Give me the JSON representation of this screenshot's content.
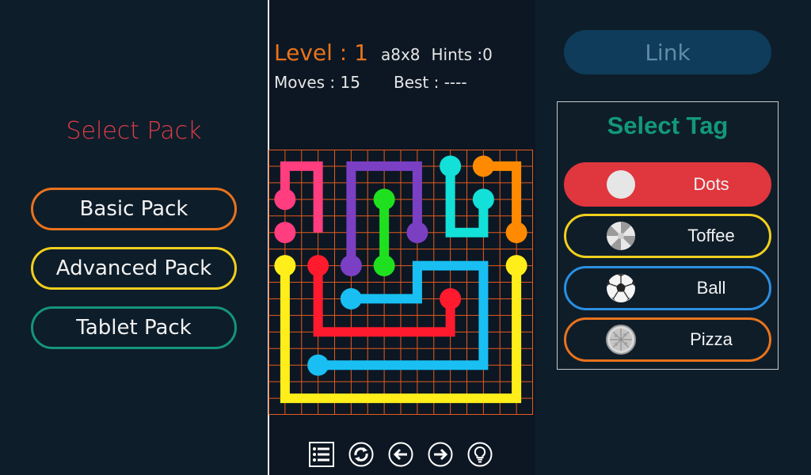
{
  "select_pack": {
    "title": "Select Pack",
    "buttons": [
      {
        "label": "Basic Pack",
        "color": "#e9731c"
      },
      {
        "label": "Advanced Pack",
        "color": "#f0cf1e"
      },
      {
        "label": "Tablet Pack",
        "color": "#14957a"
      }
    ]
  },
  "game": {
    "level_label": "Level : 1",
    "grid_size": "a8x8",
    "hints": "Hints :0",
    "moves": "Moves : 15",
    "best": "Best : ----",
    "grid": {
      "columns": 8,
      "rows": 8,
      "line_color": "#e65a1c"
    },
    "flows": [
      {
        "color": "pink",
        "hex": "#ff3d7f",
        "path": [
          [
            0,
            1
          ],
          [
            0,
            0
          ],
          [
            1,
            0
          ],
          [
            1,
            2
          ]
        ],
        "dots": [
          [
            0,
            1
          ],
          [
            0,
            2
          ]
        ]
      },
      {
        "color": "purple",
        "hex": "#7b3fc4",
        "path": [
          [
            2,
            3
          ],
          [
            2,
            0
          ],
          [
            4,
            0
          ],
          [
            4,
            2
          ]
        ],
        "dots": [
          [
            2,
            3
          ],
          [
            4,
            2
          ]
        ]
      },
      {
        "color": "green",
        "hex": "#1fe01f",
        "path": [
          [
            3,
            1
          ],
          [
            3,
            3
          ]
        ],
        "dots": [
          [
            3,
            1
          ],
          [
            3,
            3
          ]
        ]
      },
      {
        "color": "cyan",
        "hex": "#13e0d8",
        "path": [
          [
            5,
            0
          ],
          [
            5,
            2
          ],
          [
            6,
            2
          ],
          [
            6,
            1
          ]
        ],
        "dots": [
          [
            5,
            0
          ],
          [
            6,
            1
          ]
        ]
      },
      {
        "color": "orange",
        "hex": "#ff8a00",
        "path": [
          [
            6,
            0
          ],
          [
            7,
            0
          ],
          [
            7,
            2
          ]
        ],
        "dots": [
          [
            6,
            0
          ],
          [
            7,
            2
          ]
        ]
      },
      {
        "color": "yellow",
        "hex": "#ffee1a",
        "path": [
          [
            0,
            3
          ],
          [
            0,
            7
          ],
          [
            7,
            7
          ],
          [
            7,
            3
          ]
        ],
        "dots": [
          [
            0,
            3
          ],
          [
            7,
            3
          ]
        ]
      },
      {
        "color": "red",
        "hex": "#ff1a2e",
        "path": [
          [
            1,
            3
          ],
          [
            1,
            5
          ],
          [
            5,
            5
          ],
          [
            5,
            4
          ]
        ],
        "dots": [
          [
            1,
            3
          ],
          [
            5,
            4
          ]
        ]
      },
      {
        "color": "blue",
        "hex": "#19bff2",
        "path": [
          [
            2,
            4
          ],
          [
            4,
            4
          ],
          [
            4,
            3
          ],
          [
            6,
            3
          ],
          [
            6,
            6
          ],
          [
            1,
            6
          ]
        ],
        "dots": [
          [
            2,
            4
          ],
          [
            1,
            6
          ]
        ]
      }
    ]
  },
  "toolbar": {
    "icons": [
      "list-icon",
      "restart-icon",
      "previous-icon",
      "next-icon",
      "hint-icon"
    ]
  },
  "link": {
    "label": "Link"
  },
  "select_tag": {
    "title": "Select Tag",
    "tags": [
      {
        "label": "Dots",
        "icon": "dot-icon",
        "color": "#e0363d",
        "selected": true
      },
      {
        "label": "Toffee",
        "icon": "toffee-icon",
        "color": "#f0cf1e",
        "selected": false
      },
      {
        "label": "Ball",
        "icon": "soccer-ball-icon",
        "color": "#2b8fe0",
        "selected": false
      },
      {
        "label": "Pizza",
        "icon": "pizza-icon",
        "color": "#e9731c",
        "selected": false
      }
    ]
  }
}
